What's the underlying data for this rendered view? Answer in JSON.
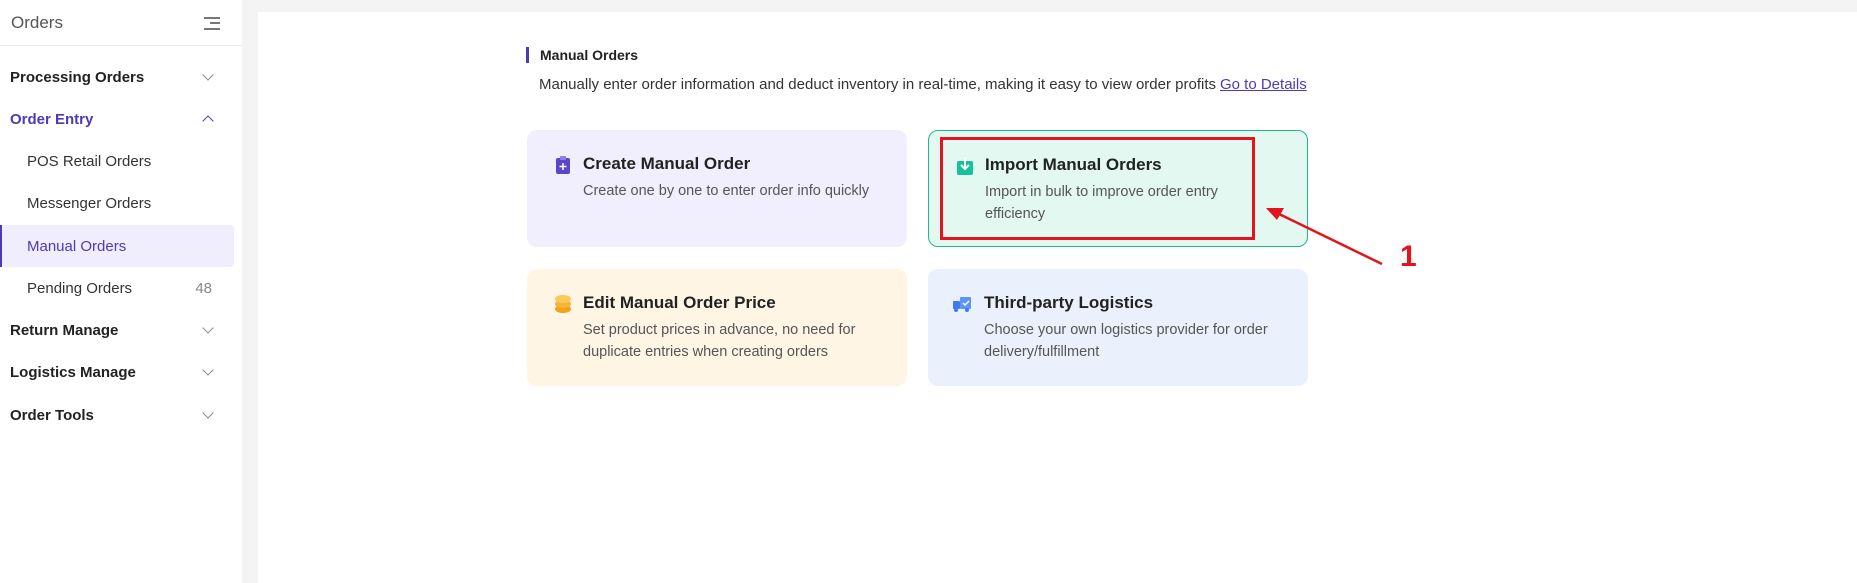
{
  "sidebar": {
    "title": "Orders",
    "items": [
      {
        "label": "Processing Orders"
      },
      {
        "label": "Order Entry"
      },
      {
        "label": "POS Retail Orders"
      },
      {
        "label": "Messenger Orders"
      },
      {
        "label": "Manual Orders"
      },
      {
        "label": "Pending Orders",
        "count": "48"
      },
      {
        "label": "Return Manage"
      },
      {
        "label": "Logistics Manage"
      },
      {
        "label": "Order Tools"
      }
    ]
  },
  "main": {
    "section_title": "Manual Orders",
    "description": "Manually enter order information and deduct inventory in real-time, making it easy to view order profits",
    "details_link": "Go to Details",
    "cards": [
      {
        "title": "Create Manual Order",
        "desc": "Create one by one to enter order info quickly",
        "icon": "clipboard-plus-icon",
        "color": "#f1effd"
      },
      {
        "title": "Import Manual Orders",
        "desc": "Import in bulk to improve order entry efficiency",
        "icon": "import-icon",
        "color": "#e3f8f1"
      },
      {
        "title": "Edit Manual Order Price",
        "desc": "Set product prices in advance, no need for duplicate entries when creating orders",
        "icon": "coins-icon",
        "color": "#fff5e4"
      },
      {
        "title": "Third-party Logistics",
        "desc": "Choose your own logistics provider for order delivery/fulfillment",
        "icon": "truck-icon",
        "color": "#eaf1fd"
      }
    ]
  },
  "annotation": {
    "label": "1",
    "color": "#e4141e"
  }
}
